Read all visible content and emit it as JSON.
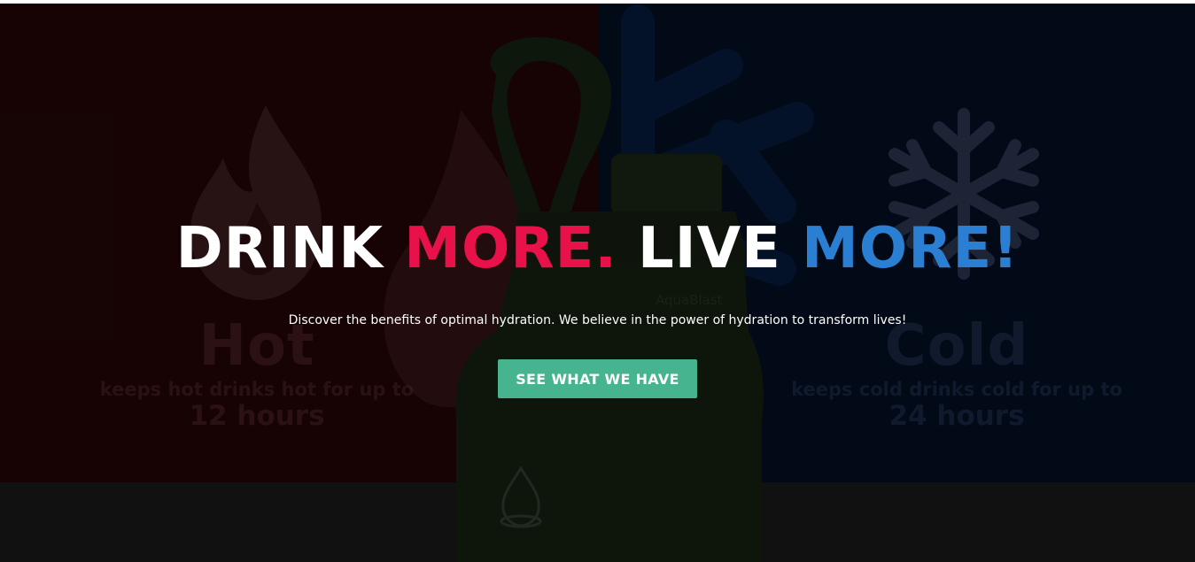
{
  "hero": {
    "headline": {
      "part1": "DRINK ",
      "part2": "MORE.",
      "part3": " LIVE ",
      "part4": "MORE!"
    },
    "tagline": "Discover the benefits of optimal hydration. We believe in the power of hydration to transform lives!",
    "cta_label": "SEE WHAT WE HAVE",
    "colors": {
      "accent_red": "#e8114a",
      "accent_blue": "#2b7fd2",
      "cta_green": "#46b58f"
    }
  },
  "background": {
    "hot": {
      "title": "Hot",
      "subtitle": "keeps hot drinks hot for up to",
      "duration": "12 hours",
      "icon": "flame-icon"
    },
    "cold": {
      "title": "Cold",
      "subtitle": "keeps cold drinks cold for up to",
      "duration": "24 hours",
      "icon": "snowflake-icon"
    },
    "bottle_brand": "AquaBlast",
    "bottle_icon": "water-drop-icon"
  }
}
